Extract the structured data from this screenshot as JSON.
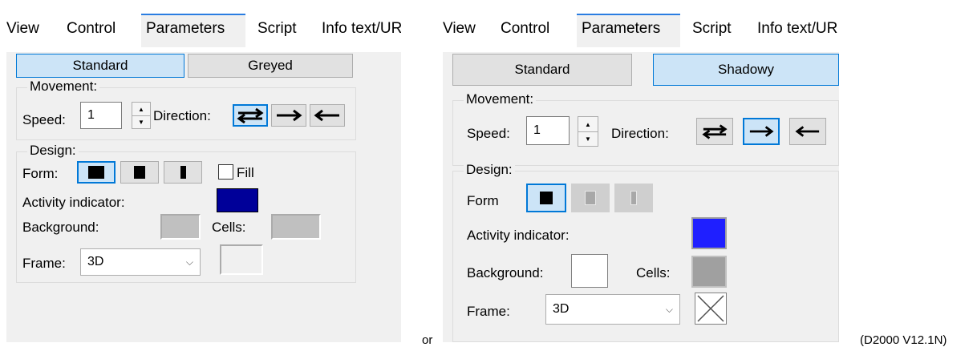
{
  "tabs": [
    "View",
    "Control",
    "Parameters",
    "Script",
    "Info text/UR"
  ],
  "active_tab": "Parameters",
  "variant_a": {
    "toggle_left": "Standard",
    "toggle_right": "Greyed",
    "movement_label": "Movement:",
    "speed_label": "Speed:",
    "speed_value": "1",
    "direction_label": "Direction:",
    "design_label": "Design:",
    "form_label": "Form:",
    "fill_label": "Fill",
    "activity_label": "Activity indicator:",
    "background_label": "Background:",
    "cells_label": "Cells:",
    "frame_label": "Frame:",
    "frame_value": "3D",
    "colors": {
      "activity": "#000099",
      "background": "#c0c0c0",
      "cells": "#c0c0c0"
    }
  },
  "variant_b": {
    "toggle_left": "Standard",
    "toggle_right": "Shadowy",
    "movement_label": "Movement:",
    "speed_label": "Speed:",
    "speed_value": "1",
    "direction_label": "Direction:",
    "design_label": "Design:",
    "form_label": "Form",
    "activity_label": "Activity indicator:",
    "background_label": "Background:",
    "cells_label": "Cells:",
    "frame_label": "Frame:",
    "frame_value": "3D",
    "colors": {
      "activity": "#1f1fff",
      "background": "#ffffff",
      "cells": "#a0a0a0"
    }
  },
  "icons": {
    "direction": [
      "bidirectional-arrows-icon",
      "right-arrow-icon",
      "left-arrow-icon"
    ],
    "form": [
      "full-block-icon",
      "medium-block-icon",
      "narrow-block-icon"
    ],
    "frame_preview_b": "x-cross-icon",
    "combo_chevron": "chevron-down-icon"
  },
  "separator": "or",
  "version": "(D2000 V12.1N)"
}
